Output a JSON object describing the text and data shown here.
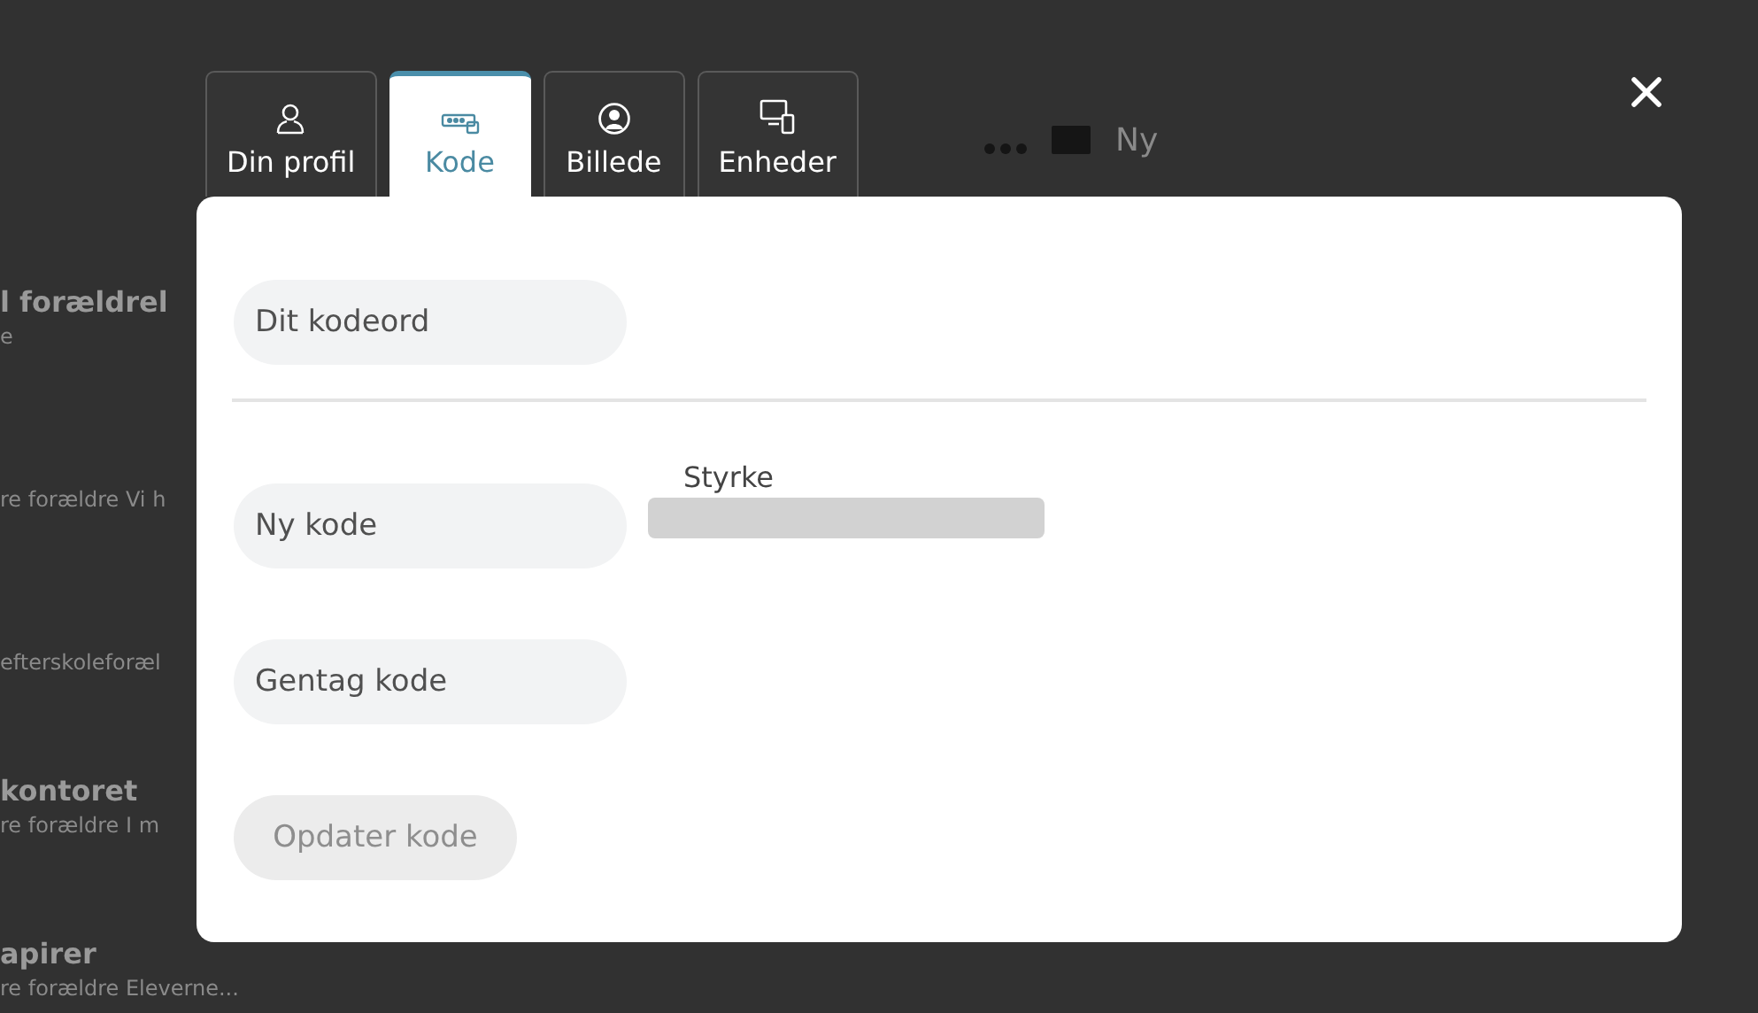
{
  "background": {
    "toolbar": {
      "new_label": "Ny"
    },
    "items": [
      {
        "title": "l forældrel",
        "subtitle": "e"
      },
      {
        "subtitle": "re forældre Vi h"
      },
      {
        "subtitle": "efterskoleforæl"
      },
      {
        "title": "kontoret",
        "subtitle": "re forældre I m"
      },
      {
        "title": "apirer",
        "subtitle": "re forældre Eleverne..."
      }
    ]
  },
  "dialog": {
    "tabs": [
      {
        "label": "Din profil",
        "selected": false
      },
      {
        "label": "Kode",
        "selected": true
      },
      {
        "label": "Billede",
        "selected": false
      },
      {
        "label": "Enheder",
        "selected": false
      }
    ],
    "current_password": {
      "placeholder": "Dit kodeord"
    },
    "new_password": {
      "placeholder": "Ny kode"
    },
    "strength": {
      "label": "Styrke",
      "level": 0
    },
    "repeat_password": {
      "placeholder": "Gentag kode"
    },
    "submit": {
      "label": "Opdater kode",
      "disabled": true
    }
  }
}
